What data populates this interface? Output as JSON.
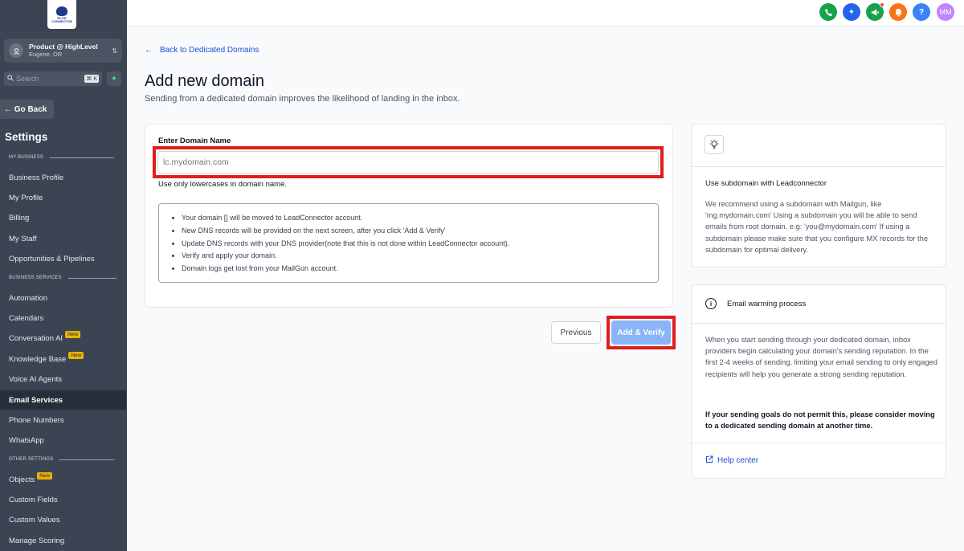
{
  "sidebar": {
    "logo_text": "ELITE CONNECTOR",
    "account": {
      "name": "Product @ HighLevel",
      "location": "Eugene, OR"
    },
    "search": {
      "placeholder": "Search",
      "shortcut": "⌘ K"
    },
    "go_back": "Go Back",
    "settings_title": "Settings",
    "sections": {
      "my_business": "MY BUSINESS",
      "business_services": "BUSINESS SERVICES",
      "other_settings": "OTHER SETTINGS"
    },
    "items": [
      {
        "label": "Business Profile"
      },
      {
        "label": "My Profile"
      },
      {
        "label": "Billing"
      },
      {
        "label": "My Staff"
      },
      {
        "label": "Opportunities & Pipelines"
      },
      {
        "label": "Automation"
      },
      {
        "label": "Calendars"
      },
      {
        "label": "Conversation AI",
        "badge": "New"
      },
      {
        "label": "Knowledge Base",
        "badge": "New"
      },
      {
        "label": "Voice AI Agents"
      },
      {
        "label": "Email Services",
        "active": true
      },
      {
        "label": "Phone Numbers"
      },
      {
        "label": "WhatsApp"
      },
      {
        "label": "Objects",
        "badge": "New"
      },
      {
        "label": "Custom Fields"
      },
      {
        "label": "Custom Values"
      },
      {
        "label": "Manage Scoring"
      }
    ]
  },
  "topbar": {
    "avatar_initials": "MM",
    "icons": [
      "phone-icon",
      "sparkle-icon",
      "megaphone-icon",
      "bell-icon",
      "help-icon"
    ],
    "colors": {
      "phone": "#16a34a",
      "sparkle": "#2563eb",
      "megaphone": "#16a34a",
      "bell": "#f97316",
      "help": "#3b82f6",
      "avatar": "#c084fc"
    }
  },
  "main": {
    "back_link": "Back to Dedicated Domains",
    "title": "Add new domain",
    "subtitle": "Sending from a dedicated domain improves the likelihood of landing in the inbox.",
    "field_label": "Enter Domain Name",
    "field_placeholder": "lc.mydomain.com",
    "field_hint": "Use only lowercases in domain name.",
    "info_items": [
      "Your domain [] will be moved to LeadConnector account.",
      "New DNS records will be provided on the next screen, after you click 'Add & Verify'",
      "Update DNS records with your DNS provider(note that this is not done within LeadConnector account).",
      "Verify and apply your domain.",
      "Domain logs get lost from your MailGun account."
    ],
    "previous_button": "Previous",
    "add_verify_button": "Add & Verify"
  },
  "subdomain_card": {
    "title": "Use subdomain with Leadconnector",
    "text": "We recommend using a subdomain with Mailgun, like 'mg.mydomain.com' Using a subdomain you will be able to send emails from root domain. e.g: 'you@mydomain.com' If using a subdomain please make sure that you configure MX records for the subdomain for optimal delivery."
  },
  "warming_card": {
    "title": "Email warming process",
    "text": "When you start sending through your dedicated domain, inbox providers begin calculating your domain's sending reputation. In the first 2-4 weeks of sending, limiting your email sending to only engaged recipients will help you generate a strong sending reputation.",
    "bold_text": "If your sending goals do not permit this, please consider moving to a dedicated sending domain at another time.",
    "help_link": "Help center"
  },
  "accent_colors": {
    "highlight": "#e11d1d",
    "link": "#1d4ed8",
    "primary_button": "#8ab4f8",
    "sidebar": "#3b4453"
  }
}
